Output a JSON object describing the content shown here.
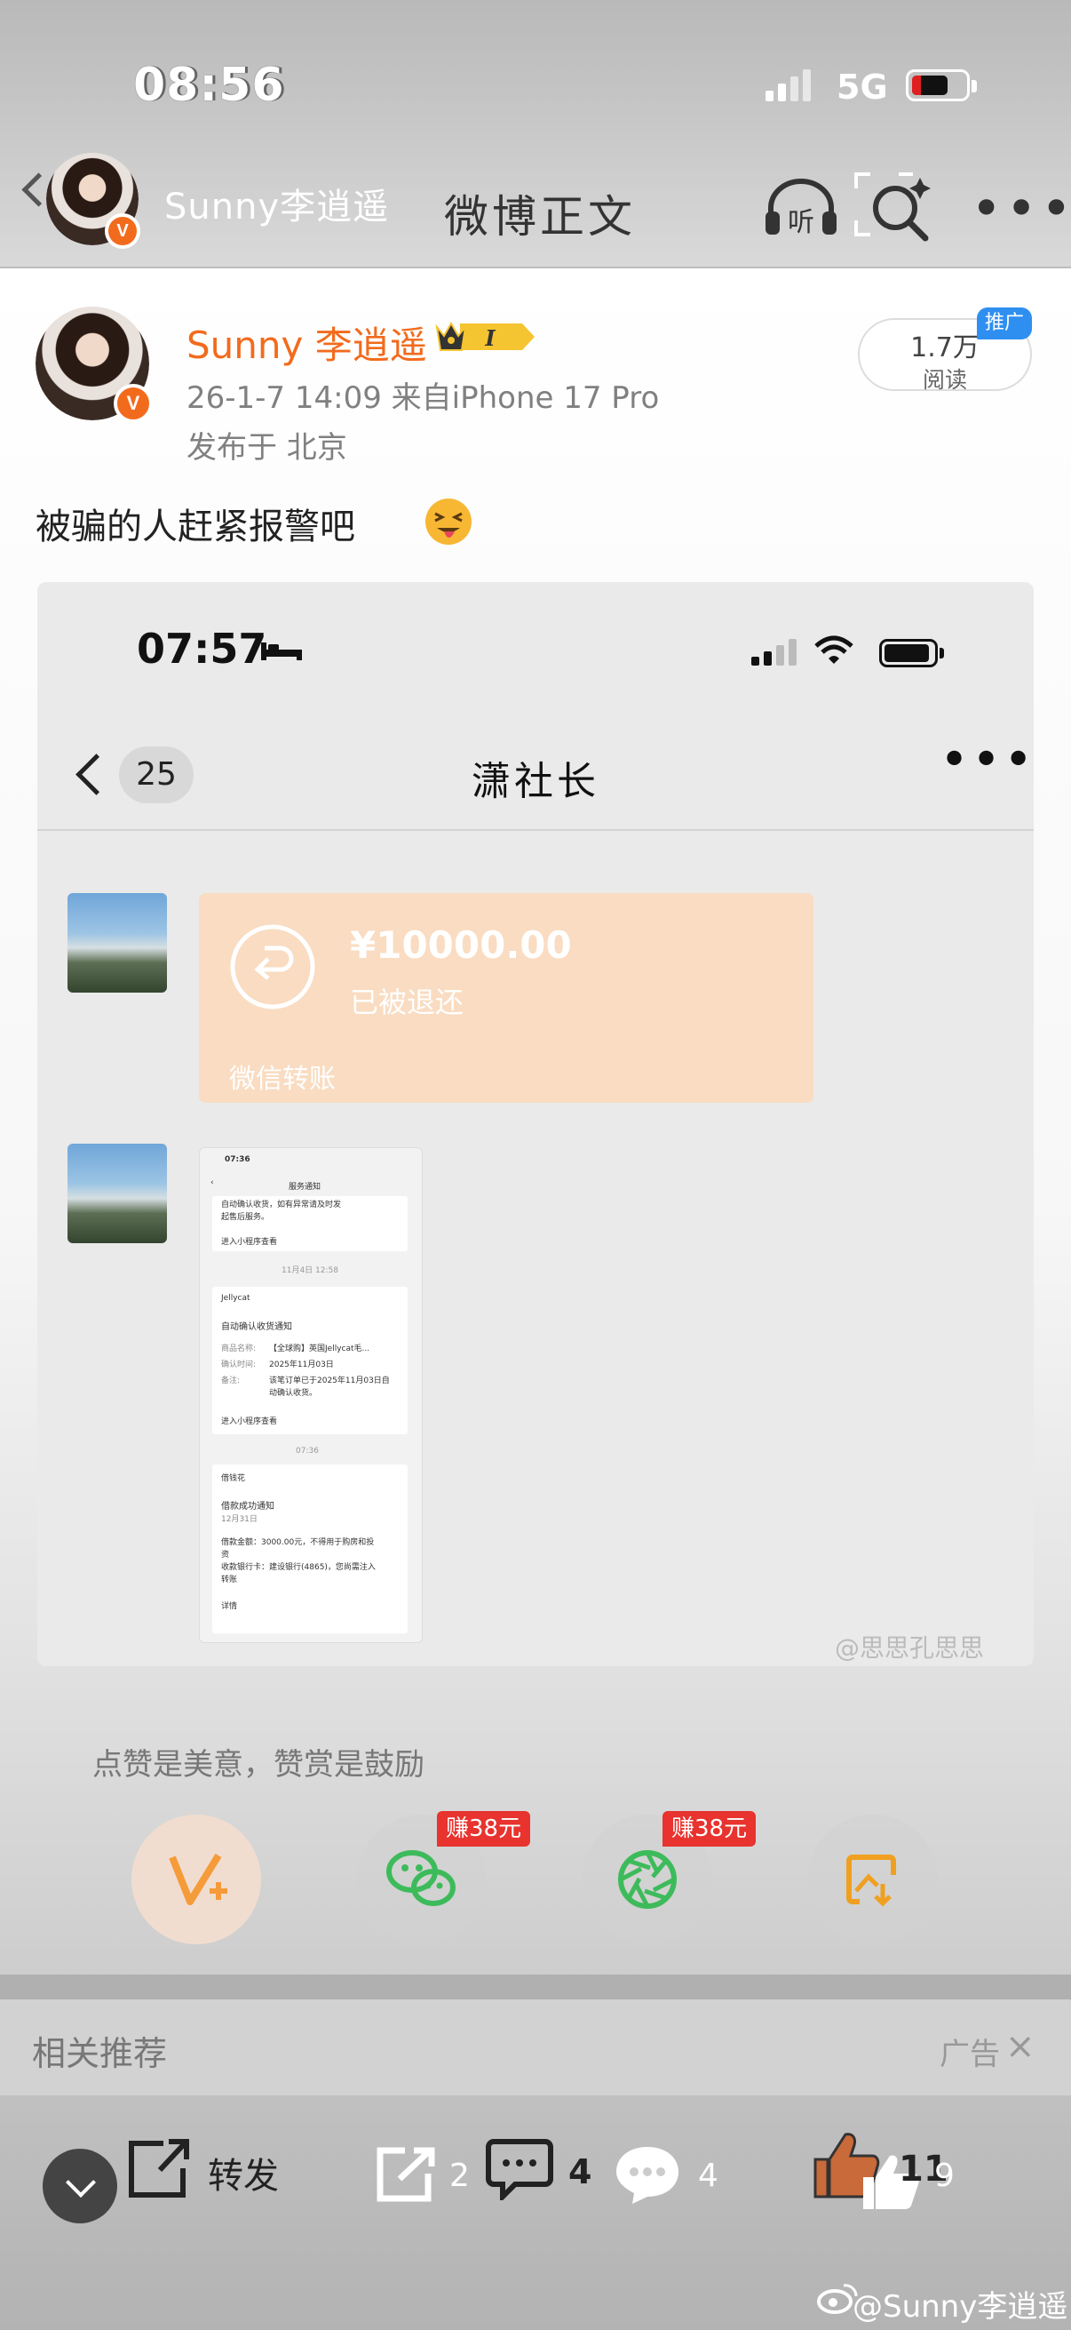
{
  "status_bar": {
    "time": "08:56",
    "network": "5G"
  },
  "nav": {
    "user_name": "Sunny李逍遥",
    "title": "微博正文",
    "listen_icon_text": "听"
  },
  "post": {
    "author": "Sunny 李逍遥",
    "level_badge": "I",
    "time_source": "26-1-7 14:09  来自iPhone 17 Pro",
    "location": "发布于 北京",
    "reads_count": "1.7万",
    "reads_label": "阅读",
    "promo_tag": "推广",
    "text": "被骗的人赶紧报警吧"
  },
  "image": {
    "status_time": "07:57",
    "back_count": "25",
    "chat_title": "潇社长",
    "transfer": {
      "amount": "¥10000.00",
      "status": "已被退还",
      "footer": "微信转账"
    },
    "inner_screenshot": {
      "time": "07:36",
      "title": "服务通知",
      "card1_lines": [
        "自动确认收货，如有异常请及时发",
        "起售后服务。"
      ],
      "card1_link": "进入小程序查看",
      "date1": "11月4日 12:58",
      "card2_brand": "Jellycat",
      "card2_title": "自动确认收货通知",
      "card2_rows": [
        [
          "商品名称:",
          "【全球购】英国Jellycat毛..."
        ],
        [
          "确认时间:",
          "2025年11月03日"
        ],
        [
          "备注:",
          "该笔订单已于2025年11月03日自"
        ],
        [
          "",
          "动确认收货。"
        ]
      ],
      "card2_link": "进入小程序查看",
      "time2": "07:36",
      "card3_brand": "借钱花",
      "card3_title": "借款成功通知",
      "card3_date": "12月31日",
      "card3_rows": [
        "借款金额：3000.00元，不得用于购房和投",
        "资",
        "收款银行卡：建设银行(4865)，您尚需注入",
        "转账"
      ],
      "card3_link": "详情"
    },
    "watermark": "@思思孔思思"
  },
  "reward": {
    "text": "点赞是美意，赞赏是鼓励",
    "earn1": "赚38元",
    "earn2": "赚38元"
  },
  "related": {
    "title": "相关推荐",
    "ad_label": "广告",
    "close": "×"
  },
  "bottom_bar": {
    "forward_label": "转发",
    "forward_count": "2",
    "comment_count": "4",
    "comment_count_2": "4",
    "like_count": "11",
    "like_count_2": "9"
  },
  "bottom_watermark": "@Sunny李逍遥",
  "colors": {
    "brand_orange": "#f26b1d",
    "earn_red": "#e8332e",
    "wechat_green": "#3dbb5b",
    "promo_blue": "#2e8ff0"
  }
}
